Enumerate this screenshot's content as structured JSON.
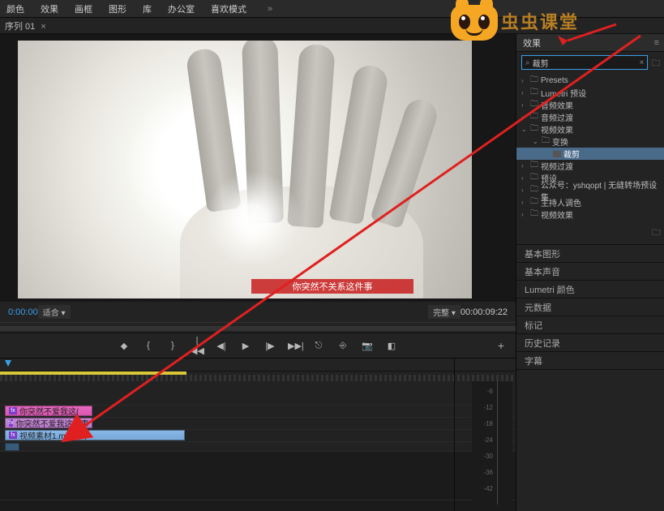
{
  "top_menu": {
    "items": [
      "颜色",
      "效果",
      "画框",
      "图形",
      "库",
      "办公室",
      "喜欢模式"
    ],
    "more": "»"
  },
  "sequence": {
    "name": "序列 01",
    "close": "×"
  },
  "monitor": {
    "caption": "你突然不关系这件事"
  },
  "controls": {
    "tc_left": "0:00:00",
    "fit": "适合 ▾",
    "qual": "完整 ▾",
    "tc_right": "00:00:09:22",
    "plus": "+"
  },
  "clips": {
    "c1": "你突然不爱我这(",
    "c2": "你突然不爱我这件事",
    "c3": "视频素材1.mp4 [V]"
  },
  "meter": {
    "labels": [
      "-6",
      "-12",
      "-18",
      "-24",
      "-30",
      "-36",
      "-42"
    ]
  },
  "effects": {
    "tab": "效果",
    "search": "裁剪",
    "items": [
      {
        "t": "Presets",
        "d": 0,
        "a": "›"
      },
      {
        "t": "Lumetri 预设",
        "d": 0,
        "a": "›"
      },
      {
        "t": "音频效果",
        "d": 0,
        "a": "›"
      },
      {
        "t": "音频过渡",
        "d": 0,
        "a": "›"
      },
      {
        "t": "视频效果",
        "d": 0,
        "a": "⌄"
      },
      {
        "t": "变换",
        "d": 1,
        "a": "⌄"
      },
      {
        "t": "裁剪",
        "d": 2,
        "a": "",
        "sel": true,
        "fx": true
      },
      {
        "t": "视频过渡",
        "d": 0,
        "a": "›"
      },
      {
        "t": "预设",
        "d": 0,
        "a": "›"
      },
      {
        "t": "公众号：yshqopt | 无缝转场预设集",
        "d": 0,
        "a": "›"
      },
      {
        "t": "主持人调色",
        "d": 0,
        "a": "›"
      },
      {
        "t": "视频效果",
        "d": 0,
        "a": "›"
      }
    ]
  },
  "panels": [
    "基本图形",
    "基本声音",
    "Lumetri 颜色",
    "元数据",
    "标记",
    "历史记录",
    "字幕"
  ],
  "watermark": "虫虫课堂"
}
